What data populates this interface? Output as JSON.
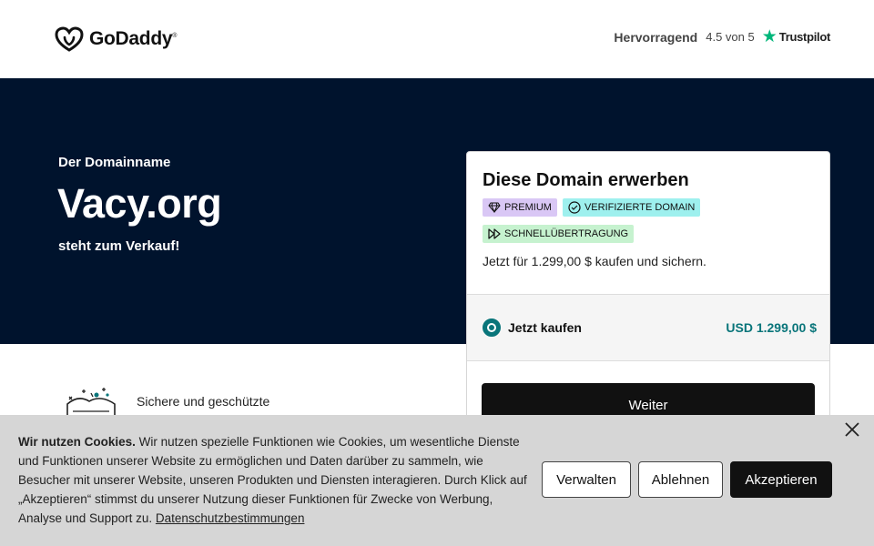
{
  "header": {
    "logo_text": "GoDaddy",
    "logo_mark": "®",
    "rating_word": "Hervorragend",
    "rating_score": "4.5 von 5",
    "trustpilot": "Trustpilot"
  },
  "hero": {
    "subtitle": "Der Domainname",
    "domain": "Vacy.org",
    "for_sale": "steht zum Verkauf!"
  },
  "feature": {
    "text": "Sichere und geschützte"
  },
  "card": {
    "title": "Diese Domain erwerben",
    "badges": [
      {
        "label": "PREMIUM",
        "icon": "diamond-icon",
        "color": "#d9c7f5"
      },
      {
        "label": "VERIFIZIERTE DOMAIN",
        "icon": "check-circle-icon",
        "color": "#9ef0ee"
      },
      {
        "label": "SCHNELLÜBERTRAGUNG",
        "icon": "fast-forward-icon",
        "color": "#c6f2cf"
      }
    ],
    "price_line": "Jetzt für 1.299,00 $ kaufen und sichern.",
    "option_label": "Jetzt kaufen",
    "option_price": "USD 1.299,00 $",
    "continue_label": "Weiter"
  },
  "cookie": {
    "heading": "Wir nutzen Cookies.",
    "body": " Wir nutzen spezielle Funktionen wie Cookies, um wesentliche Dienste und Funktionen unserer Website zu ermöglichen und Daten darüber zu sammeln, wie Besucher mit unserer Website, unseren Produkten und Diensten interagieren. Durch Klick auf „Akzeptieren“ stimmst du unserer Nutzung dieser Funktionen für Zwecke von Werbung, Analyse und Support zu. ",
    "link": "Datenschutzbestimmungen",
    "manage": "Verwalten",
    "reject": "Ablehnen",
    "accept": "Akzeptieren"
  },
  "colors": {
    "hero_bg": "#00132d",
    "accent_teal": "#09757a",
    "trustpilot_green": "#00b67a"
  }
}
